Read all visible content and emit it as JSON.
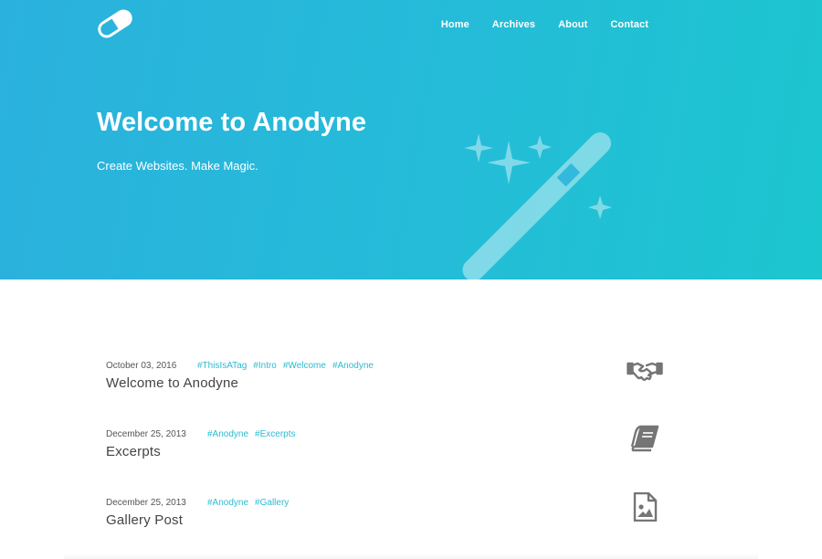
{
  "brand": {
    "logo_icon": "pill-icon"
  },
  "nav": {
    "items": [
      {
        "label": "Home"
      },
      {
        "label": "Archives"
      },
      {
        "label": "About"
      },
      {
        "label": "Contact"
      }
    ]
  },
  "hero": {
    "title": "Welcome to Anodyne",
    "subtitle": "Create Websites. Make Magic.",
    "illustration": "magic-wand-icon",
    "gradient_start": "#2bb1de",
    "gradient_end": "#1cc6cf"
  },
  "posts": [
    {
      "date": "October 03, 2016",
      "tags": [
        "#ThisIsATag",
        "#Intro",
        "#Welcome",
        "#Anodyne"
      ],
      "title": "Welcome to Anodyne",
      "icon": "handshake-icon"
    },
    {
      "date": "December 25, 2013",
      "tags": [
        "#Anodyne",
        "#Excerpts"
      ],
      "title": "Excerpts",
      "icon": "book-icon"
    },
    {
      "date": "December 25, 2013",
      "tags": [
        "#Anodyne",
        "#Gallery"
      ],
      "title": "Gallery Post",
      "icon": "image-file-icon"
    }
  ],
  "colors": {
    "accent": "#2bbbd1",
    "text": "#444444"
  }
}
